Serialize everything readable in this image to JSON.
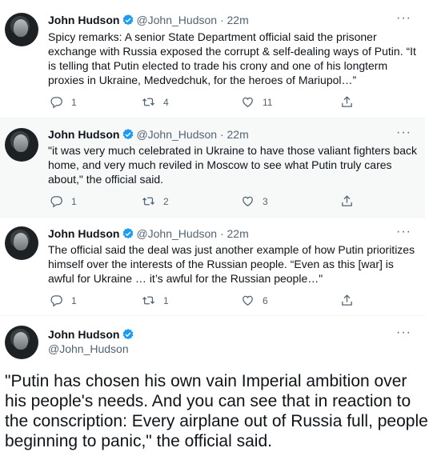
{
  "colors": {
    "accent": "#1d9bf0",
    "muted": "#536471",
    "text": "#0f1419",
    "highlight": "#f7f9f9"
  },
  "icons": {
    "verified": "verified-badge-icon",
    "reply": "reply-icon",
    "retweet": "retweet-icon",
    "like": "heart-icon",
    "share": "share-icon",
    "more": "more-horizontal-icon"
  },
  "tweets": [
    {
      "name": "John Hudson",
      "handle": "@John_Hudson",
      "dot": "·",
      "time": "22m",
      "more": "···",
      "text": "Spicy remarks: A senior State Department official said the prisoner exchange with Russia exposed the corrupt & self-dealing ways of Putin. “It is telling that Putin elected to trade his crony and one of his longterm proxies in Ukraine, Medvedchuk, for the heroes of Mariupol…”",
      "replies": "1",
      "retweets": "4",
      "likes": "11"
    },
    {
      "name": "John Hudson",
      "handle": "@John_Hudson",
      "dot": "·",
      "time": "22m",
      "more": "···",
      "text": "\"it was very much celebrated in Ukraine to have those valiant fighters back home, and very much reviled in Moscow to see what Putin truly cares about,\" the official said.",
      "replies": "1",
      "retweets": "2",
      "likes": "3"
    },
    {
      "name": "John Hudson",
      "handle": "@John_Hudson",
      "dot": "·",
      "time": "22m",
      "more": "···",
      "text": "The official said the deal was just another example of how Putin prioritizes himself over the interests of the Russian people. “Even as this [war] is awful for Ukraine … it’s awful for the Russian people…\"",
      "replies": "1",
      "retweets": "1",
      "likes": "6"
    }
  ],
  "main_tweet": {
    "name": "John Hudson",
    "handle": "@John_Hudson",
    "more": "···",
    "text": "\"Putin has chosen his own vain Imperial ambition over his people's needs. And you can see that in reaction to the conscription: Every airplane out of Russia full, people beginning to panic,\" the official said."
  }
}
